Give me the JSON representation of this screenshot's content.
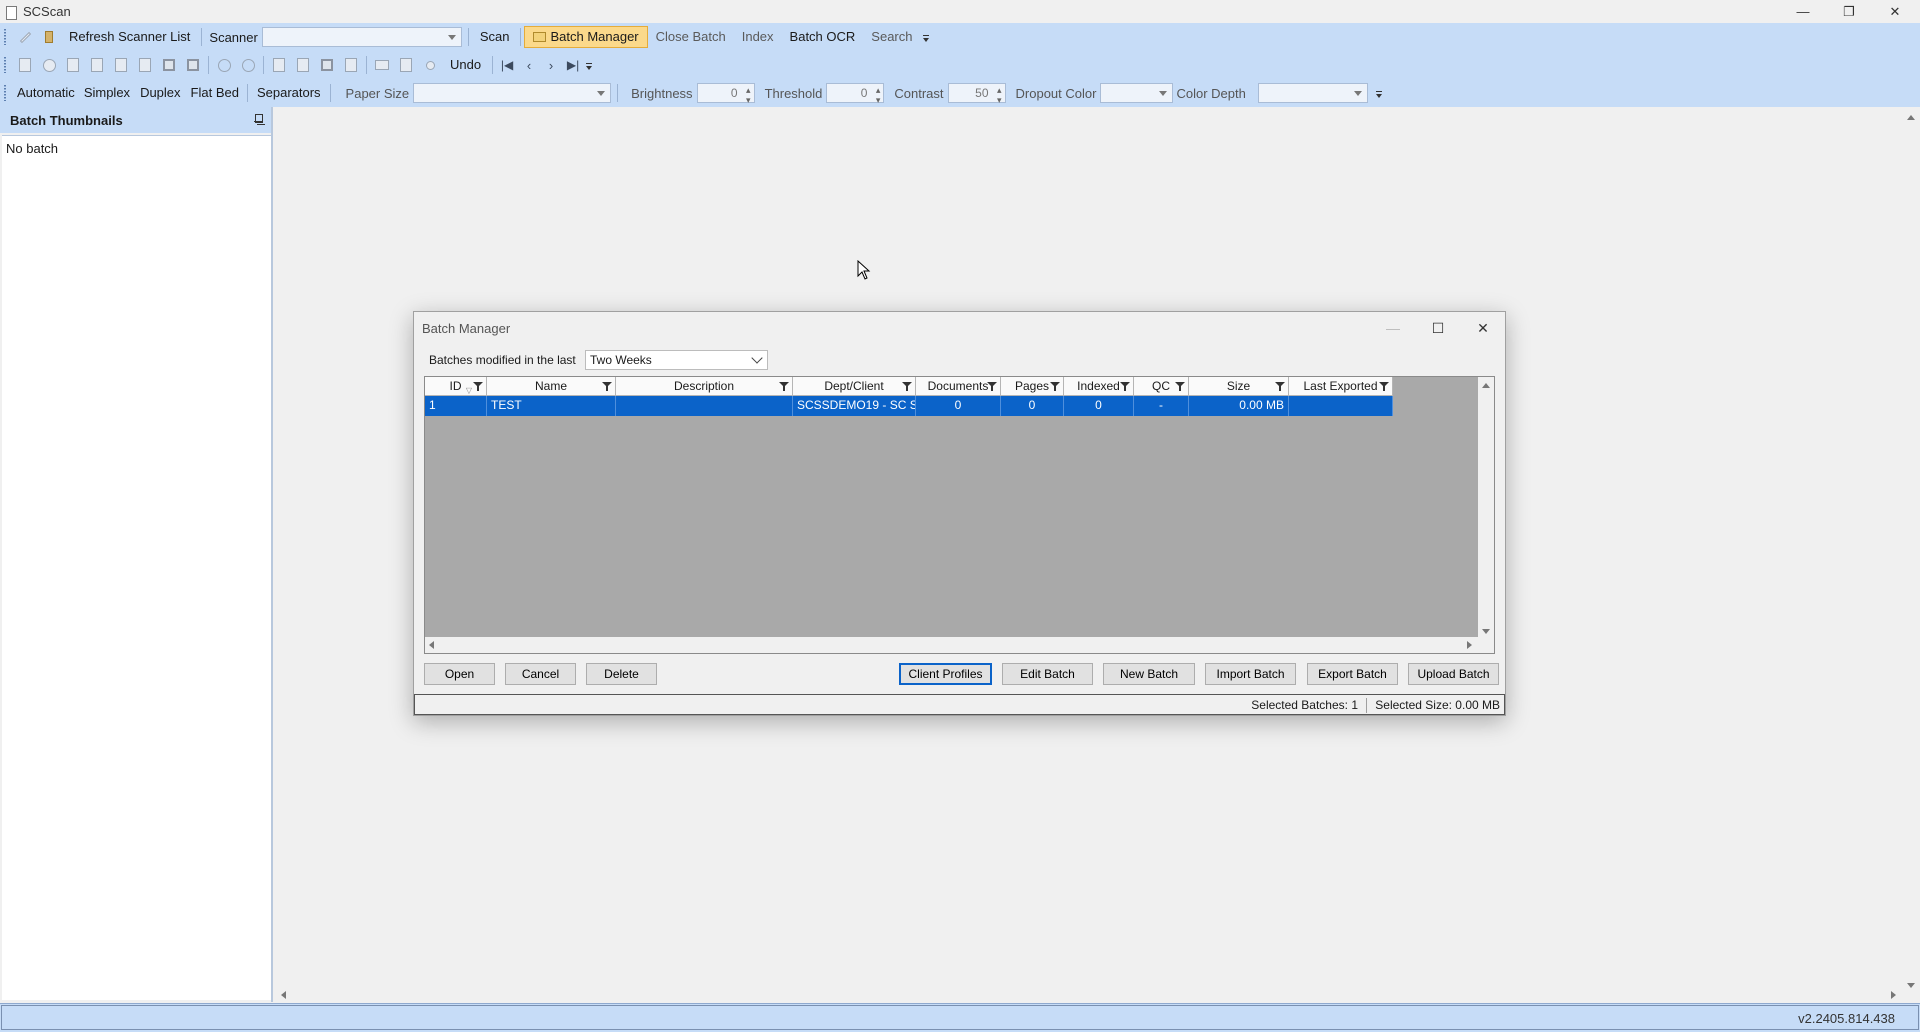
{
  "app": {
    "title": "SCScan"
  },
  "window_controls": {
    "minimize": "—",
    "restore": "❐",
    "close": "✕"
  },
  "toolbar1": {
    "refresh_label": "Refresh Scanner List",
    "scanner_label": "Scanner",
    "scanner_value": "",
    "scan_label": "Scan",
    "batch_manager_label": "Batch Manager",
    "close_batch_label": "Close Batch",
    "index_label": "Index",
    "batch_ocr_label": "Batch OCR",
    "search_label": "Search"
  },
  "toolbar2": {
    "undo_label": "Undo"
  },
  "toolbar3": {
    "automatic_label": "Automatic",
    "simplex_label": "Simplex",
    "duplex_label": "Duplex",
    "flatbed_label": "Flat Bed",
    "separators_label": "Separators",
    "paper_size_label": "Paper Size",
    "brightness_label": "Brightness",
    "brightness_value": "0",
    "threshold_label": "Threshold",
    "threshold_value": "0",
    "contrast_label": "Contrast",
    "contrast_value": "50",
    "dropout_label": "Dropout Color",
    "color_depth_label": "Color Depth"
  },
  "panel": {
    "title": "Batch Thumbnails",
    "empty_text": "No batch"
  },
  "status": {
    "version": "v2.2405.814.438"
  },
  "dialog": {
    "title": "Batch Manager",
    "filter_label": "Batches modified in the last",
    "filter_value": "Two Weeks",
    "columns": [
      "ID",
      "Name",
      "Description",
      "Dept/Client",
      "Documents",
      "Pages",
      "Indexed",
      "QC",
      "Size",
      "Last Exported"
    ],
    "rows": [
      {
        "id": "1",
        "name": "TEST",
        "description": "",
        "dept_client": "SCSSDEMO19 - SC S",
        "documents": "0",
        "pages": "0",
        "indexed": "0",
        "qc": "-",
        "size": "0.00 MB",
        "last_exported": ""
      }
    ],
    "buttons": {
      "open": "Open",
      "cancel": "Cancel",
      "delete": "Delete",
      "client_profiles": "Client Profiles",
      "edit_batch": "Edit Batch",
      "new_batch": "New Batch",
      "import_batch": "Import Batch",
      "export_batch": "Export Batch",
      "upload_batch": "Upload Batch"
    },
    "status": {
      "selected_batches": "Selected Batches: 1",
      "selected_size": "Selected Size: 0.00 MB"
    }
  },
  "colors": {
    "ribbon": "#c6dcf7",
    "selection": "#0b63c9",
    "active_button": "#fbd98b"
  }
}
